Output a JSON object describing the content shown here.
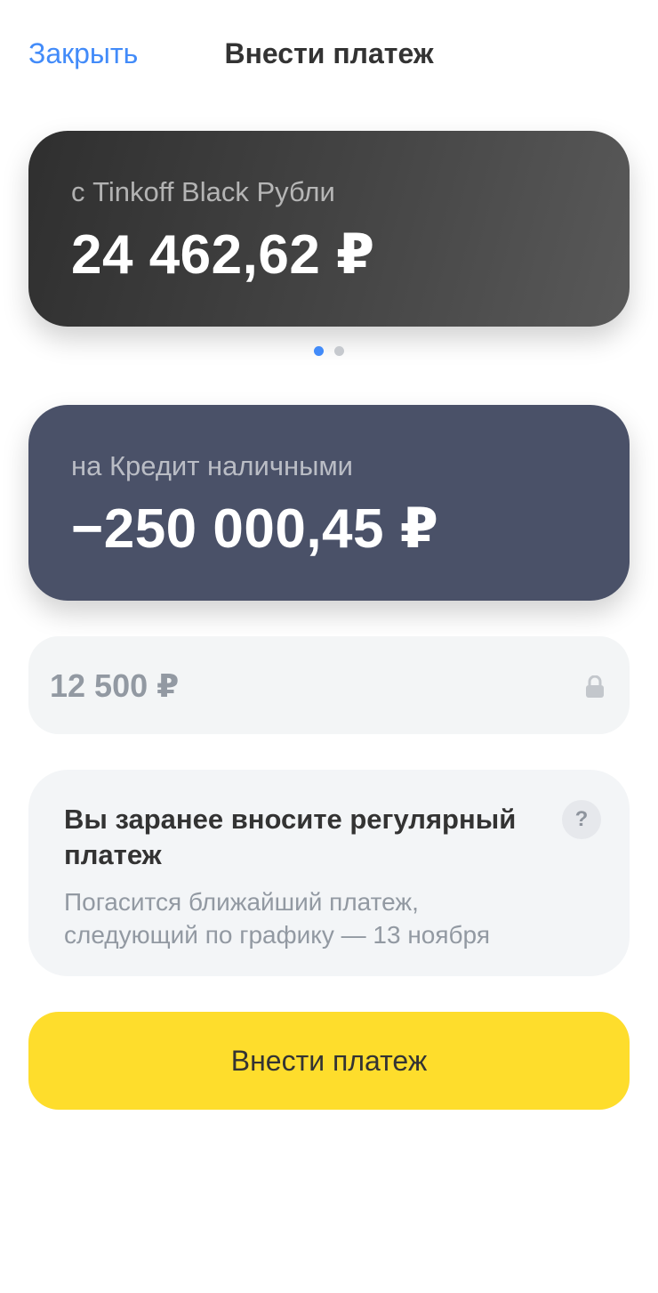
{
  "header": {
    "close_label": "Закрыть",
    "title": "Внести платеж"
  },
  "source_card": {
    "label": "с Tinkoff Black Рубли",
    "amount": "24 462,62 ₽"
  },
  "pager": {
    "total": 2,
    "active_index": 0
  },
  "target_card": {
    "label": "на Кредит наличными",
    "amount": "−250 000,45 ₽"
  },
  "amount_field": {
    "value": "12 500 ₽",
    "icon": "lock-icon"
  },
  "info": {
    "title": "Вы заранее вносите регулярный платеж",
    "text_line1": "Погасится ближайший платеж,",
    "text_line2": "следующий по графику — 13 ноября",
    "help_label": "?"
  },
  "submit": {
    "label": "Внести платеж"
  },
  "colors": {
    "accent_blue": "#428bf9",
    "button_yellow": "#fedd2c",
    "target_card_bg": "#4a5168"
  }
}
